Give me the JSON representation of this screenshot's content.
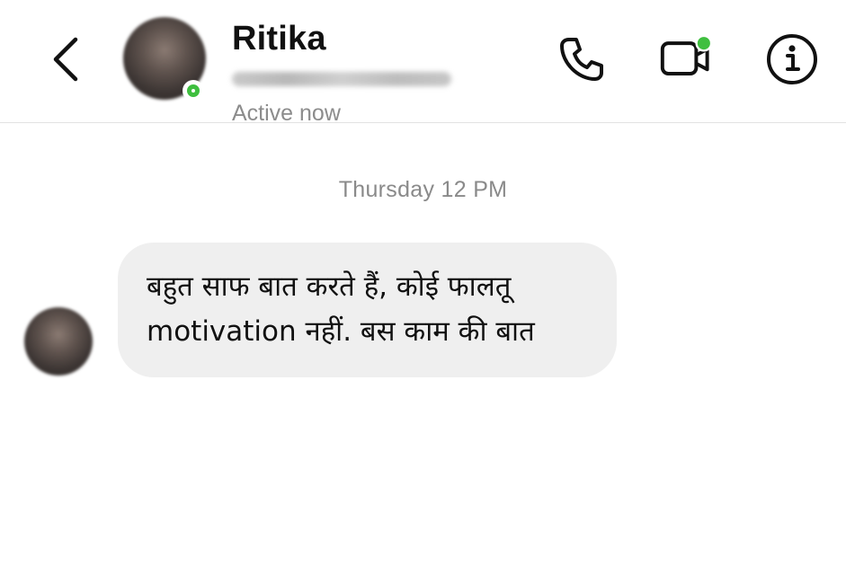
{
  "header": {
    "back_label": "Back",
    "contact_name": "Ritika",
    "status": "Active now"
  },
  "icons": {
    "back": "chevron-left-icon",
    "phone": "phone-icon",
    "video": "video-camera-icon",
    "info": "info-icon"
  },
  "colors": {
    "online_green": "#3fbf3f",
    "bubble_bg": "#efefef",
    "muted_text": "#8a8a8a",
    "divider": "#e2e2e2"
  },
  "conversation": {
    "timestamp": "Thursday 12 PM",
    "messages": [
      {
        "sender": "Ritika",
        "lines": [
          "बहुत साफ बात करते हैं, कोई फालतू",
          "motivation नहीं. बस काम की बात"
        ]
      }
    ]
  }
}
